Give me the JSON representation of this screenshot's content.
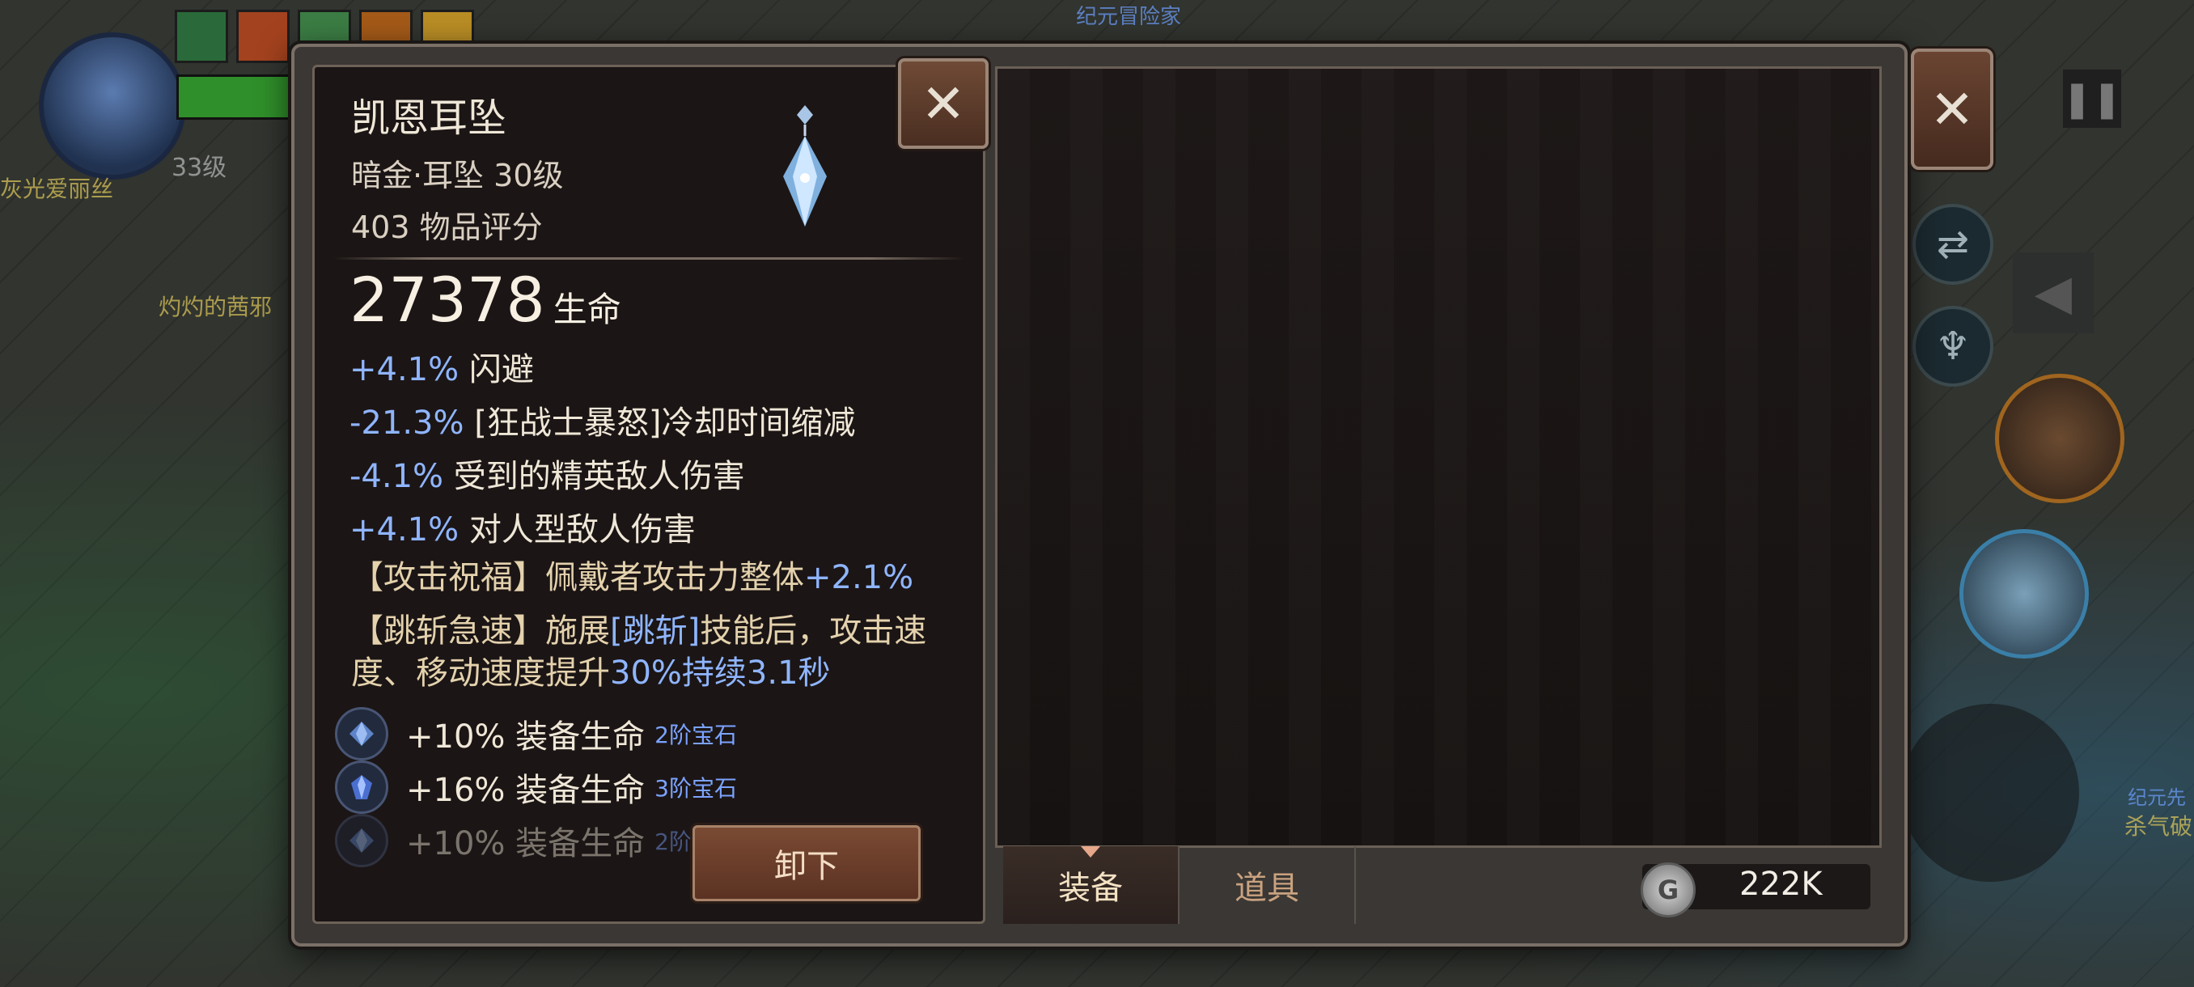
{
  "hud": {
    "player_name": "灰光爱丽丝",
    "level": "33级",
    "npc_name_1": "灼灼的茜邪",
    "npc_name_2": "纪元冒险家",
    "npc_name_3": "杀气破",
    "npc_name_4": "纪元先"
  },
  "item": {
    "name": "凯恩耳坠",
    "subtitle": "暗金·耳坠 30级",
    "score": "403 物品评分",
    "main_stat_value": "27378",
    "main_stat_label": "生命",
    "stats": [
      {
        "value": "+4.1%",
        "label": "闪避"
      },
      {
        "value": "-21.3%",
        "label": "[狂战士暴怒]冷却时间缩减"
      },
      {
        "value": "-4.1%",
        "label": "受到的精英敌人伤害"
      },
      {
        "value": "+4.1%",
        "label": "对人型敌人伤害"
      }
    ],
    "blessing_1": {
      "title": "【攻击祝福】",
      "text": "佩戴者攻击力整体",
      "value": "+2.1%"
    },
    "blessing_2": {
      "title": "【跳斩急速】",
      "text_a": "施展",
      "skill": "[跳斩]",
      "text_b": "技能后，攻击速度、移动速度提升",
      "value": "30%持续3.1秒"
    },
    "gems": [
      {
        "text": "+10% 装备生命",
        "tier": "2阶宝石"
      },
      {
        "text": "+16% 装备生命",
        "tier": "3阶宝石"
      },
      {
        "text": "+10% 装备生命",
        "tier": "2阶宝石"
      }
    ],
    "unequip_label": "卸下"
  },
  "tabs": [
    {
      "label": "装备",
      "active": true
    },
    {
      "label": "道具",
      "active": false
    }
  ],
  "currency": {
    "icon": "G",
    "value": "222K"
  },
  "colors": {
    "positive_value": "#8fb5ff",
    "gem_tier": "#7ba3ff",
    "blessing": "#e4d2ad"
  }
}
